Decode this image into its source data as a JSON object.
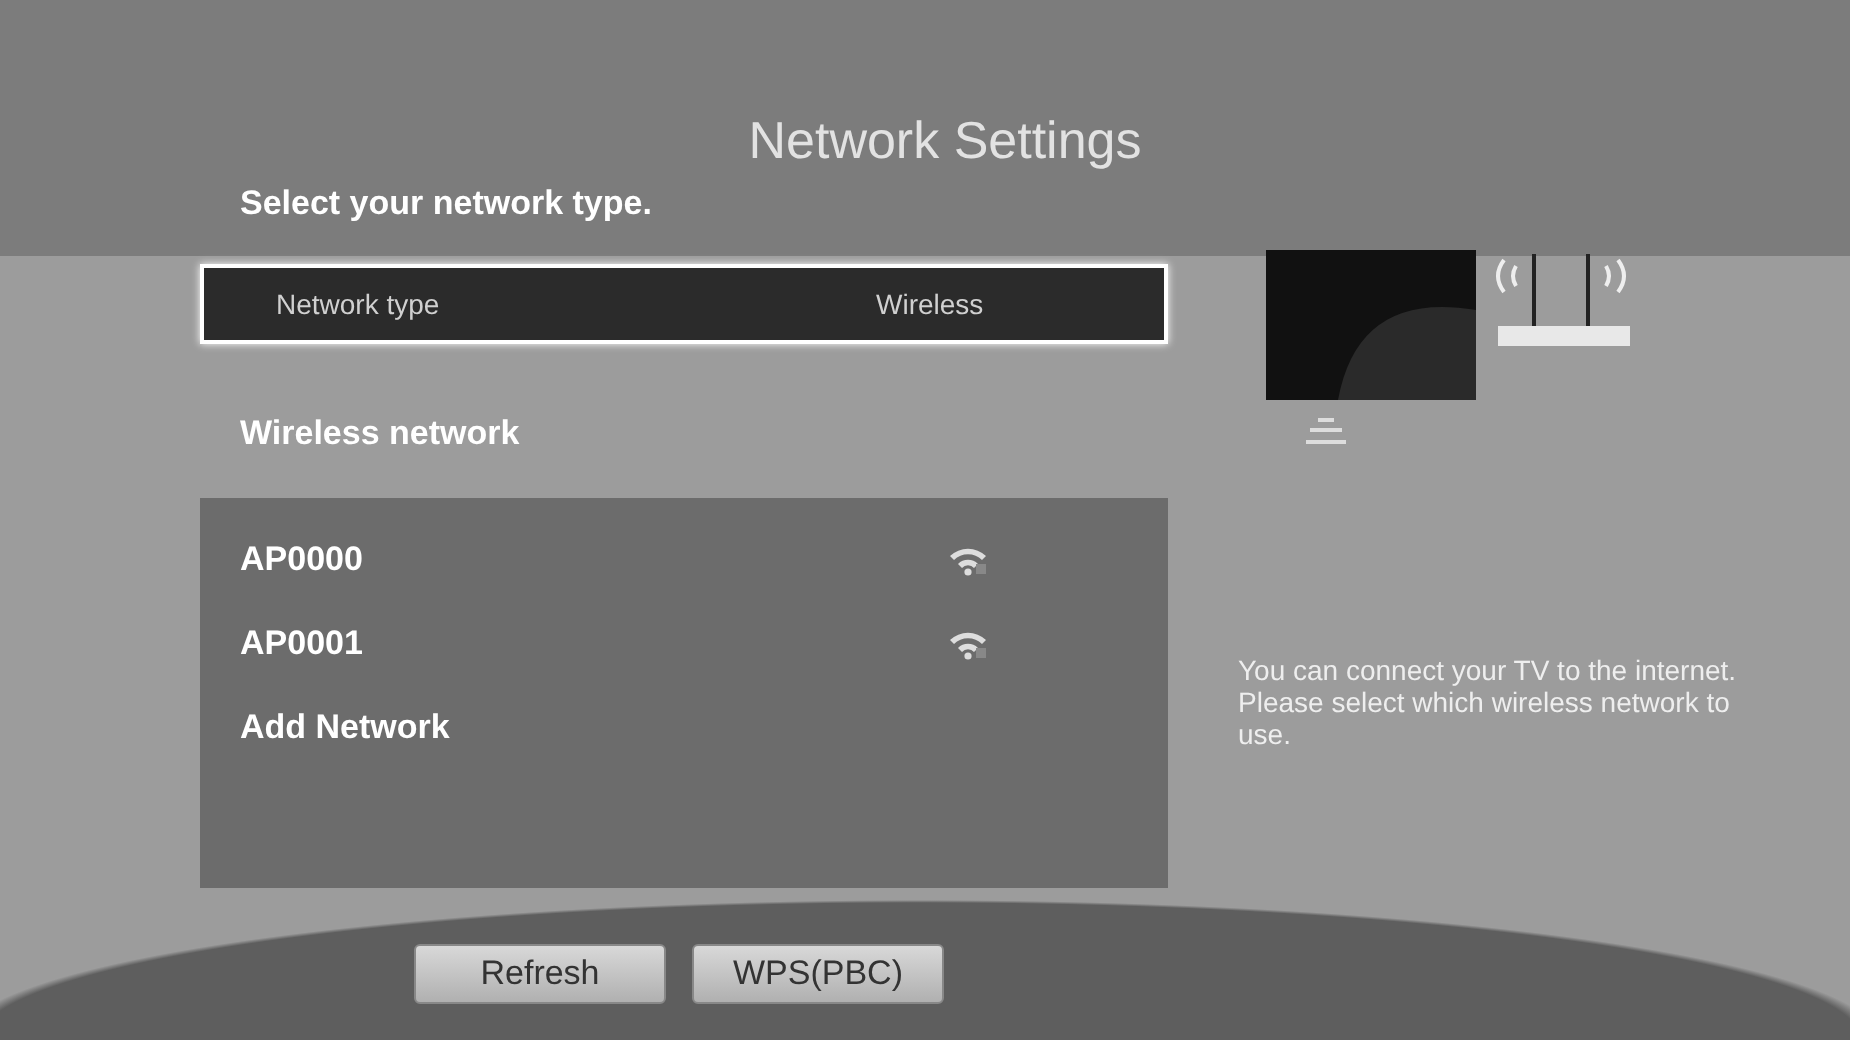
{
  "title": "Network Settings",
  "prompt": "Select your network type.",
  "network_type": {
    "label": "Network type",
    "value": "Wireless",
    "focused": true
  },
  "section_label": "Wireless network",
  "networks": [
    {
      "kind": "access_point",
      "name": "AP0000"
    },
    {
      "kind": "access_point",
      "name": "AP0001"
    },
    {
      "kind": "action",
      "name": "Add Network"
    }
  ],
  "help_text": "You can connect your TV to the internet. Please select which wireless network to use.",
  "buttons": [
    "Refresh",
    "WPS(PBC)"
  ]
}
